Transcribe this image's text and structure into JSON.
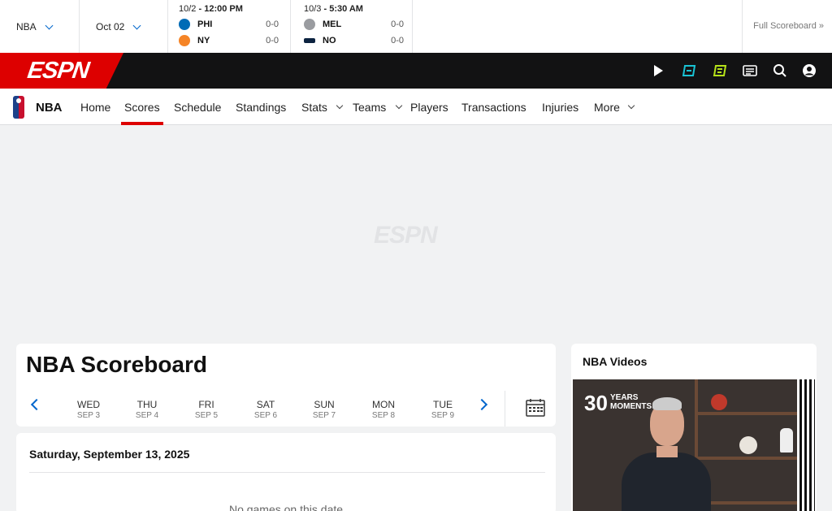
{
  "scores_strip": {
    "league_select": "NBA",
    "date_select": "Oct 02",
    "games": [
      {
        "date": "10/2",
        "time": "12:00 PM",
        "teams": [
          {
            "abbr": "PHI",
            "record": "0-0",
            "color": "#006bb6"
          },
          {
            "abbr": "NY",
            "record": "0-0",
            "color": "#f58426"
          }
        ]
      },
      {
        "date": "10/3",
        "time": "5:30 AM",
        "teams": [
          {
            "abbr": "MEL",
            "record": "0-0",
            "color": "#9a9ca0"
          },
          {
            "abbr": "NO",
            "record": "0-0",
            "color": "#0c2340"
          }
        ]
      }
    ],
    "full_scoreboard": "Full Scoreboard »"
  },
  "brand": {
    "logo_text": "ESPN",
    "accent": "#dd0000"
  },
  "subnav": {
    "league": "NBA",
    "items": [
      "Home",
      "Scores",
      "Schedule",
      "Standings",
      "Stats",
      "Teams",
      "Players",
      "Transactions",
      "Injuries",
      "More"
    ],
    "active": "Scores"
  },
  "scoreboard": {
    "title": "NBA Scoreboard",
    "days": [
      {
        "dow": "WED",
        "date": "SEP 3"
      },
      {
        "dow": "THU",
        "date": "SEP 4"
      },
      {
        "dow": "FRI",
        "date": "SEP 5"
      },
      {
        "dow": "SAT",
        "date": "SEP 6"
      },
      {
        "dow": "SUN",
        "date": "SEP 7"
      },
      {
        "dow": "MON",
        "date": "SEP 8"
      },
      {
        "dow": "TUE",
        "date": "SEP 9"
      }
    ],
    "date_heading": "Saturday, September 13, 2025",
    "empty_message": "No games on this date"
  },
  "videos": {
    "title": "NBA Videos",
    "thumb_text_big": "30",
    "thumb_text_years": "YEARS",
    "thumb_text_moments": "MOMENTS"
  },
  "watermark": "ESPN",
  "icons": [
    "watch-icon",
    "espn-plus-icon",
    "fantasy-icon",
    "news-icon",
    "search-icon",
    "profile-icon",
    "calendar-icon"
  ]
}
